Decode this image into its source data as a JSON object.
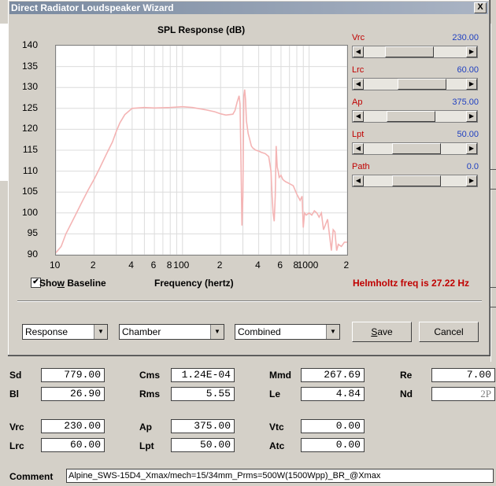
{
  "window": {
    "title": "Direct Radiator Loudspeaker Wizard",
    "close_glyph": "X"
  },
  "chart_title": "SPL Response (dB)",
  "chart_data": {
    "type": "line",
    "title": "SPL Response (dB)",
    "xlabel": "Frequency (hertz)",
    "ylabel": "",
    "x_scale": "log",
    "xlim": [
      10,
      2000
    ],
    "ylim": [
      90,
      140
    ],
    "y_ticks": [
      "140",
      "135",
      "130",
      "125",
      "120",
      "115",
      "110",
      "105",
      "100",
      "95",
      "90"
    ],
    "x_ticks": [
      "10",
      "2",
      "4",
      "6",
      "8",
      "100",
      "2",
      "4",
      "6",
      "8",
      "1000",
      "2"
    ],
    "series": [
      {
        "color": "#f4b4b4",
        "x": [
          10,
          11,
          12,
          14,
          16,
          18,
          20,
          22,
          25,
          28,
          30,
          32,
          35,
          40,
          50,
          60,
          80,
          100,
          120,
          150,
          180,
          200,
          220,
          250,
          260,
          270,
          280,
          285,
          290,
          295,
          300,
          305,
          310,
          315,
          320,
          330,
          340,
          350,
          360,
          380,
          400,
          420,
          450,
          480,
          500,
          510,
          520,
          530,
          540,
          550,
          560,
          570,
          580,
          600,
          620,
          650,
          680,
          700,
          750,
          800,
          850,
          880,
          900,
          920,
          950,
          1000,
          1050,
          1100,
          1150,
          1200,
          1250,
          1300,
          1400,
          1500,
          1550,
          1600,
          1650,
          1700,
          1800,
          1900,
          2000
        ],
        "y": [
          90.5,
          92,
          95,
          99,
          102.5,
          105.5,
          108,
          110.5,
          114,
          117,
          119.5,
          121.5,
          123.5,
          125,
          125.2,
          125.1,
          125.2,
          125.4,
          125.2,
          124.7,
          124.2,
          123.7,
          123.4,
          123.6,
          124.5,
          126.5,
          128,
          126,
          111,
          97,
          104,
          128,
          129.5,
          127,
          122,
          119,
          117.5,
          116,
          115.5,
          115,
          114.8,
          114.5,
          114.2,
          113.5,
          110,
          104,
          100,
          98,
          104,
          116,
          111,
          110,
          108.5,
          109,
          108,
          107.5,
          107.2,
          107,
          106.5,
          104.5,
          103,
          104,
          96.5,
          100,
          99.5,
          100,
          99.5,
          100.5,
          100,
          99,
          100,
          96,
          98.5,
          91,
          96,
          95.5,
          91,
          92.5,
          92,
          93,
          93
        ]
      }
    ]
  },
  "sliders": [
    {
      "name": "Vrc",
      "value": "230.00",
      "thumb": 0.38
    },
    {
      "name": "Lrc",
      "value": "60.00",
      "thumb": 0.62
    },
    {
      "name": "Ap",
      "value": "375.00",
      "thumb": 0.42
    },
    {
      "name": "Lpt",
      "value": "50.00",
      "thumb": 0.52
    },
    {
      "name": "Path",
      "value": "0.0",
      "thumb": 0.52
    }
  ],
  "show_baseline": {
    "label_before": "Sho",
    "label_u": "w",
    "label_after": " Baseline",
    "checked": "✔"
  },
  "xlabel": "Frequency (hertz)",
  "helmholtz": "Helmholtz freq is 27.22 Hz",
  "combos": {
    "view": "Response",
    "component": "Chamber",
    "mode": "Combined"
  },
  "buttons": {
    "save_u": "S",
    "save_rest": "ave",
    "cancel": "Cancel"
  },
  "params": {
    "Sd": "779.00",
    "Bl": "26.90",
    "Cms": "1.24E-04",
    "Rms": "5.55",
    "Mmd": "267.69",
    "Le": "4.84",
    "Re": "7.00",
    "Nd": "2P",
    "Vrc": "230.00",
    "Lrc": "60.00",
    "Ap": "375.00",
    "Lpt": "50.00",
    "Vtc": "0.00",
    "Atc": "0.00"
  },
  "param_labels": {
    "Sd": "Sd",
    "Bl": "Bl",
    "Cms": "Cms",
    "Rms": "Rms",
    "Mmd": "Mmd",
    "Le": "Le",
    "Re": "Re",
    "Nd": "Nd",
    "Vrc": "Vrc",
    "Lrc": "Lrc",
    "Ap": "Ap",
    "Lpt": "Lpt",
    "Vtc": "Vtc",
    "Atc": "Atc",
    "Comment": "Comment"
  },
  "comment": "Alpine_SWS-15D4_Xmax/mech=15/34mm_Prms=500W(1500Wpp)_BR_@Xmax",
  "scroll_glyphs": {
    "left": "◀",
    "right": "▶",
    "down": "▼"
  }
}
